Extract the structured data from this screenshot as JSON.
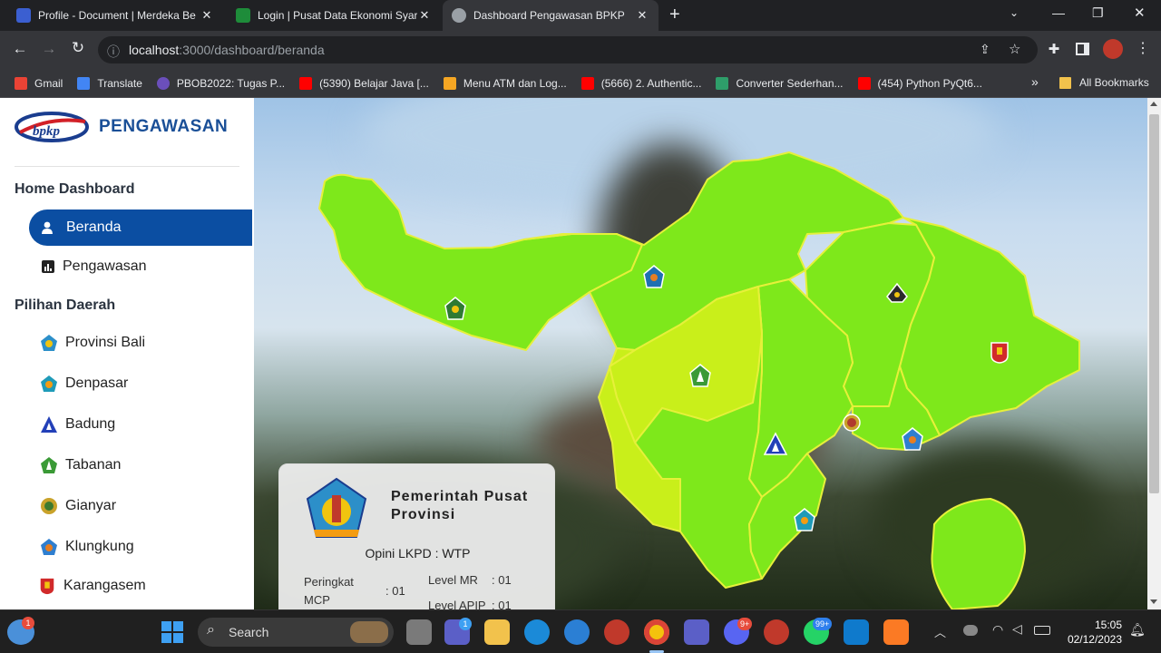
{
  "browser": {
    "tabs": [
      {
        "title": "Profile - Document | Merdeka Be",
        "favicon_color": "#3b5fd1"
      },
      {
        "title": "Login | Pusat Data Ekonomi Syar",
        "favicon_color": "#1e8c3a"
      },
      {
        "title": "Dashboard Pengawasan BPKP",
        "favicon_color": "#9aa0a6"
      }
    ],
    "new_tab": "+",
    "url_host": "localhost",
    "url_path": ":3000/dashboard/beranda",
    "bookmarks": [
      {
        "label": "Gmail",
        "color": "#ea4335"
      },
      {
        "label": "Translate",
        "color": "#4285f4"
      },
      {
        "label": "PBOB2022: Tugas P...",
        "color": "#6b4fbb"
      },
      {
        "label": "(5390) Belajar Java [...",
        "color": "#ff0000"
      },
      {
        "label": "Menu ATM dan Log...",
        "color": "#f5a623"
      },
      {
        "label": "(5666) 2. Authentic...",
        "color": "#ff0000"
      },
      {
        "label": "Converter Sederhan...",
        "color": "#2e9e6a"
      },
      {
        "label": "(454) Python PyQt6...",
        "color": "#ff0000"
      }
    ],
    "more_bookmarks": "»",
    "all_bookmarks": "All Bookmarks"
  },
  "sidebar": {
    "brand_logo_text": "bpkp",
    "brand": "PENGAWASAN",
    "section_home": "Home Dashboard",
    "home_items": [
      {
        "label": "Beranda",
        "icon": "user-icon"
      },
      {
        "label": "Pengawasan",
        "icon": "bar-chart-icon"
      }
    ],
    "section_regions": "Pilihan Daerah",
    "regions": [
      {
        "label": "Provinsi Bali",
        "color": "#2c8fc9"
      },
      {
        "label": "Denpasar",
        "color": "#1f9bb8"
      },
      {
        "label": "Badung",
        "color": "#2340b8"
      },
      {
        "label": "Tabanan",
        "color": "#3a9a36"
      },
      {
        "label": "Gianyar",
        "color": "#c9a22a"
      },
      {
        "label": "Klungkung",
        "color": "#2f7fd0"
      },
      {
        "label": "Karangasem",
        "color": "#d12a2a"
      }
    ]
  },
  "info_card": {
    "title": "Pemerintah Pusat Provinsi",
    "opini_label": "Opini LKPD : WTP",
    "peringkat_label": "Peringkat MCP",
    "peringkat_value": ": 01",
    "level_mr_label": "Level MR",
    "level_mr_value": ": 01",
    "level_apip_label": "Level APIP",
    "level_apip_value": ": 01"
  },
  "map": {
    "land_color": "#7ee81b",
    "highlight_color": "#c9ef1a",
    "border_color": "#e6f03a"
  },
  "taskbar": {
    "search_label": "Search",
    "time": "15:05",
    "date": "02/12/2023",
    "badges": {
      "widgets": "1",
      "chat": "1",
      "discord": "9+",
      "whatsapp": "99+"
    }
  }
}
